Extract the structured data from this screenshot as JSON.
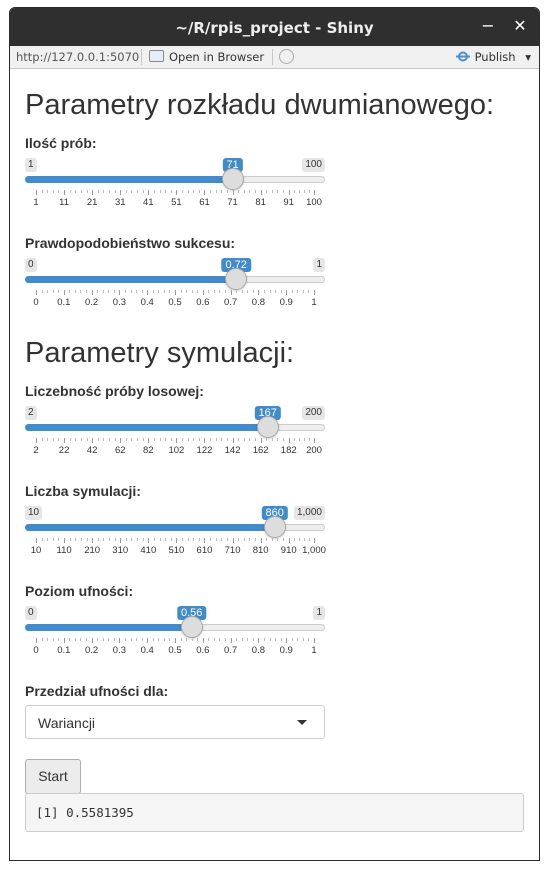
{
  "window": {
    "title": "~/R/rpis_project - Shiny",
    "minimize_label": "−",
    "close_label": "✕"
  },
  "toolbar": {
    "url": "http://127.0.0.1:5070",
    "open_in_browser": "Open in Browser",
    "publish": "Publish",
    "publish_caret": "▾"
  },
  "section1": {
    "heading": "Parametry rozkładu dwumianowego:",
    "sliders": [
      {
        "label": "Ilość prób:",
        "min": "1",
        "max": "100",
        "value": "71",
        "min_num": 1,
        "max_num": 100,
        "value_num": 71,
        "ticks": [
          "1",
          "11",
          "21",
          "31",
          "41",
          "51",
          "61",
          "71",
          "81",
          "91",
          "100"
        ],
        "tick_values": [
          1,
          11,
          21,
          31,
          41,
          51,
          61,
          71,
          81,
          91,
          100
        ]
      },
      {
        "label": "Prawdopodobieństwo sukcesu:",
        "min": "0",
        "max": "1",
        "value": "0.72",
        "min_num": 0,
        "max_num": 1,
        "value_num": 0.72,
        "ticks": [
          "0",
          "0.1",
          "0.2",
          "0.3",
          "0.4",
          "0.5",
          "0.6",
          "0.7",
          "0.8",
          "0.9",
          "1"
        ],
        "tick_values": [
          0,
          0.1,
          0.2,
          0.3,
          0.4,
          0.5,
          0.6,
          0.7,
          0.8,
          0.9,
          1
        ]
      }
    ]
  },
  "section2": {
    "heading": "Parametry symulacji:",
    "sliders": [
      {
        "label": "Liczebność próby losowej:",
        "min": "2",
        "max": "200",
        "value": "167",
        "min_num": 2,
        "max_num": 200,
        "value_num": 167,
        "ticks": [
          "2",
          "22",
          "42",
          "62",
          "82",
          "102",
          "122",
          "142",
          "162",
          "182",
          "200"
        ],
        "tick_values": [
          2,
          22,
          42,
          62,
          82,
          102,
          122,
          142,
          162,
          182,
          200
        ]
      },
      {
        "label": "Liczba symulacji:",
        "min": "10",
        "max": "1,000",
        "value": "860",
        "min_num": 10,
        "max_num": 1000,
        "value_num": 860,
        "ticks": [
          "10",
          "110",
          "210",
          "310",
          "410",
          "510",
          "610",
          "710",
          "810",
          "910",
          "1,000"
        ],
        "tick_values": [
          10,
          110,
          210,
          310,
          410,
          510,
          610,
          710,
          810,
          910,
          1000
        ]
      },
      {
        "label": "Poziom ufności:",
        "min": "0",
        "max": "1",
        "value": "0.56",
        "min_num": 0,
        "max_num": 1,
        "value_num": 0.56,
        "ticks": [
          "0",
          "0.1",
          "0.2",
          "0.3",
          "0.4",
          "0.5",
          "0.6",
          "0.7",
          "0.8",
          "0.9",
          "1"
        ],
        "tick_values": [
          0,
          0.1,
          0.2,
          0.3,
          0.4,
          0.5,
          0.6,
          0.7,
          0.8,
          0.9,
          1
        ]
      }
    ],
    "select_label": "Przedział ufności dla:",
    "select_value": "Wariancji",
    "button_label": "Start",
    "output_text": "[1] 0.5581395"
  },
  "colors": {
    "accent": "#428bca",
    "titlebar": "#2f2f2f"
  }
}
